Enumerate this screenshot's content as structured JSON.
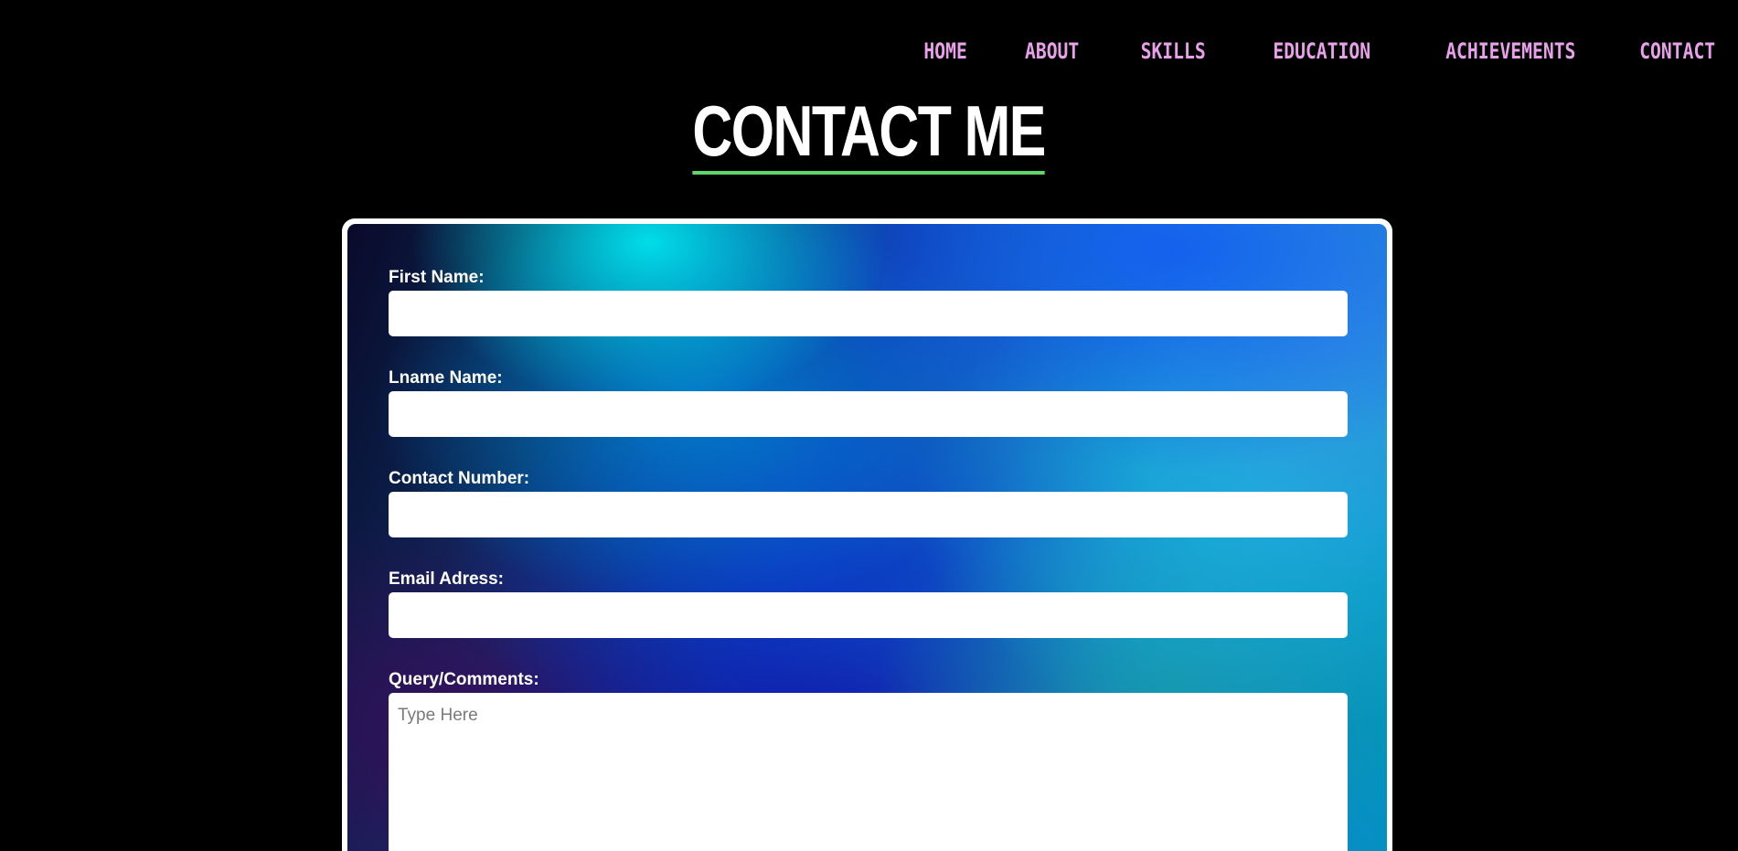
{
  "nav": {
    "items": [
      {
        "label": "HOME"
      },
      {
        "label": "ABOUT"
      },
      {
        "label": "SKILLS"
      },
      {
        "label": "EDUCATION"
      },
      {
        "label": "ACHIEVEMENTS"
      },
      {
        "label": "CONTACT"
      }
    ],
    "color": "#e9a0ea"
  },
  "page_title": "CONTACT ME",
  "title_underline_color": "#5ed66a",
  "form": {
    "first_name": {
      "label": "First Name:",
      "value": ""
    },
    "last_name": {
      "label": "Lname Name:",
      "value": ""
    },
    "contact_number": {
      "label": "Contact Number:",
      "value": ""
    },
    "email": {
      "label": "Email Adress:",
      "value": ""
    },
    "comments": {
      "label": "Query/Comments:",
      "placeholder": "Type Here",
      "value": ""
    }
  }
}
